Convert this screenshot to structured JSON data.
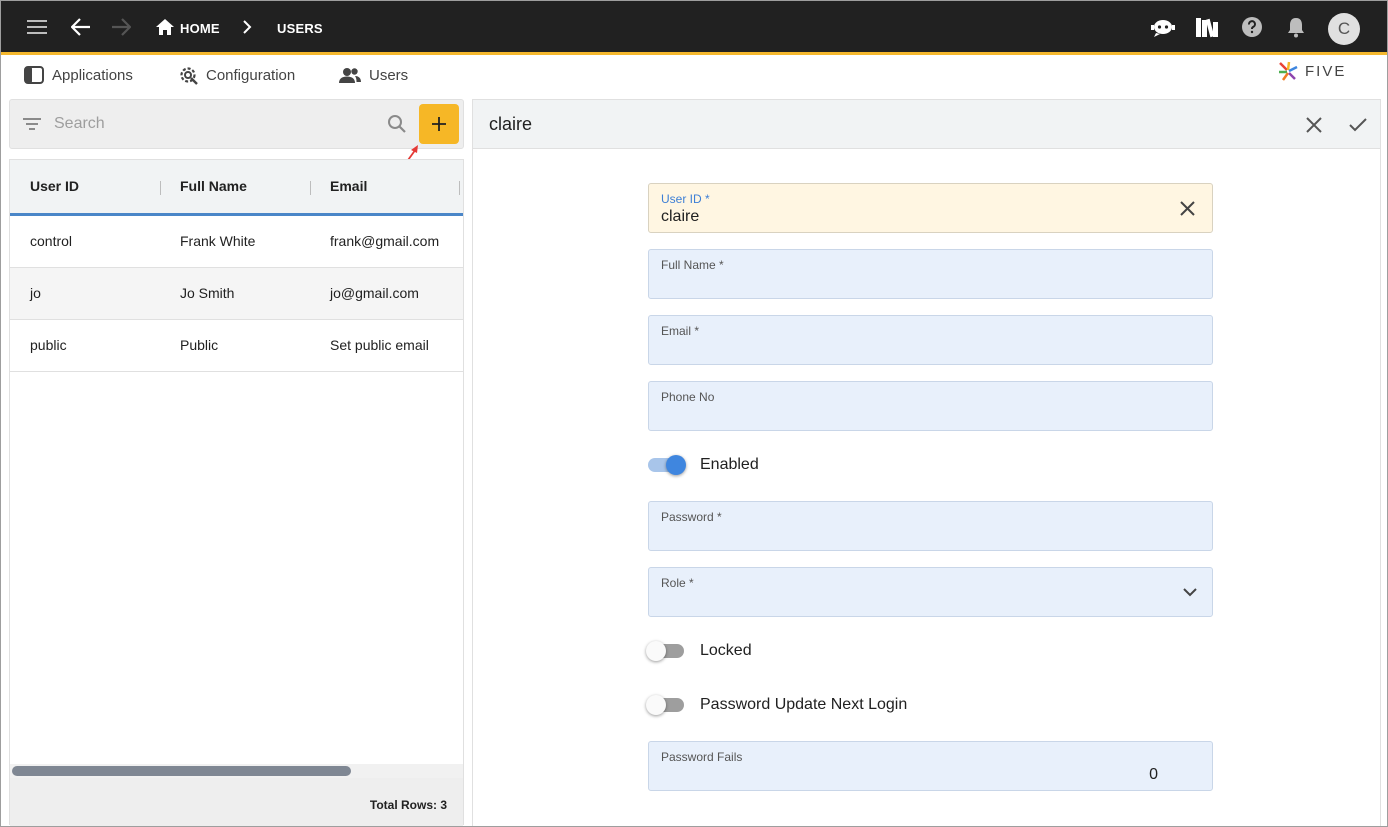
{
  "topbar": {
    "breadcrumb_home": "HOME",
    "breadcrumb_users": "USERS",
    "avatar_initial": "C",
    "icons": [
      "menu-icon",
      "back-arrow-icon",
      "forward-arrow-icon",
      "home-icon",
      "chevron-right-icon",
      "chat-bot-icon",
      "library-icon",
      "help-icon",
      "bell-icon"
    ]
  },
  "menu": {
    "applications": "Applications",
    "configuration": "Configuration",
    "users": "Users"
  },
  "logo": {
    "text": "FIVE"
  },
  "search": {
    "placeholder": "Search"
  },
  "table": {
    "columns": [
      "User ID",
      "Full Name",
      "Email"
    ],
    "rows": [
      [
        "control",
        "Frank White",
        "frank@gmail.com"
      ],
      [
        "jo",
        "Jo Smith",
        "jo@gmail.com"
      ],
      [
        "public",
        "Public",
        "Set public email"
      ]
    ],
    "total": "Total Rows: 3"
  },
  "detail": {
    "title": "claire",
    "fields": {
      "user_id": {
        "label": "User ID *",
        "value": "claire"
      },
      "full_name": {
        "label": "Full Name *",
        "value": ""
      },
      "email": {
        "label": "Email *",
        "value": ""
      },
      "phone": {
        "label": "Phone No",
        "value": ""
      },
      "password": {
        "label": "Password *",
        "value": ""
      },
      "role": {
        "label": "Role *",
        "value": ""
      },
      "password_fails": {
        "label": "Password Fails",
        "value": "0"
      }
    },
    "toggles": {
      "enabled": {
        "label": "Enabled",
        "on": true
      },
      "locked": {
        "label": "Locked",
        "on": false
      },
      "password_update": {
        "label": "Password Update Next Login",
        "on": false
      }
    }
  },
  "colors": {
    "topbar": "#212121",
    "accent": "#f6b726",
    "table_underline": "#4a86c8",
    "field_bg": "#e8f0fb",
    "focus_field_bg": "#fff6e2",
    "toggle_on": "#3f86df"
  }
}
